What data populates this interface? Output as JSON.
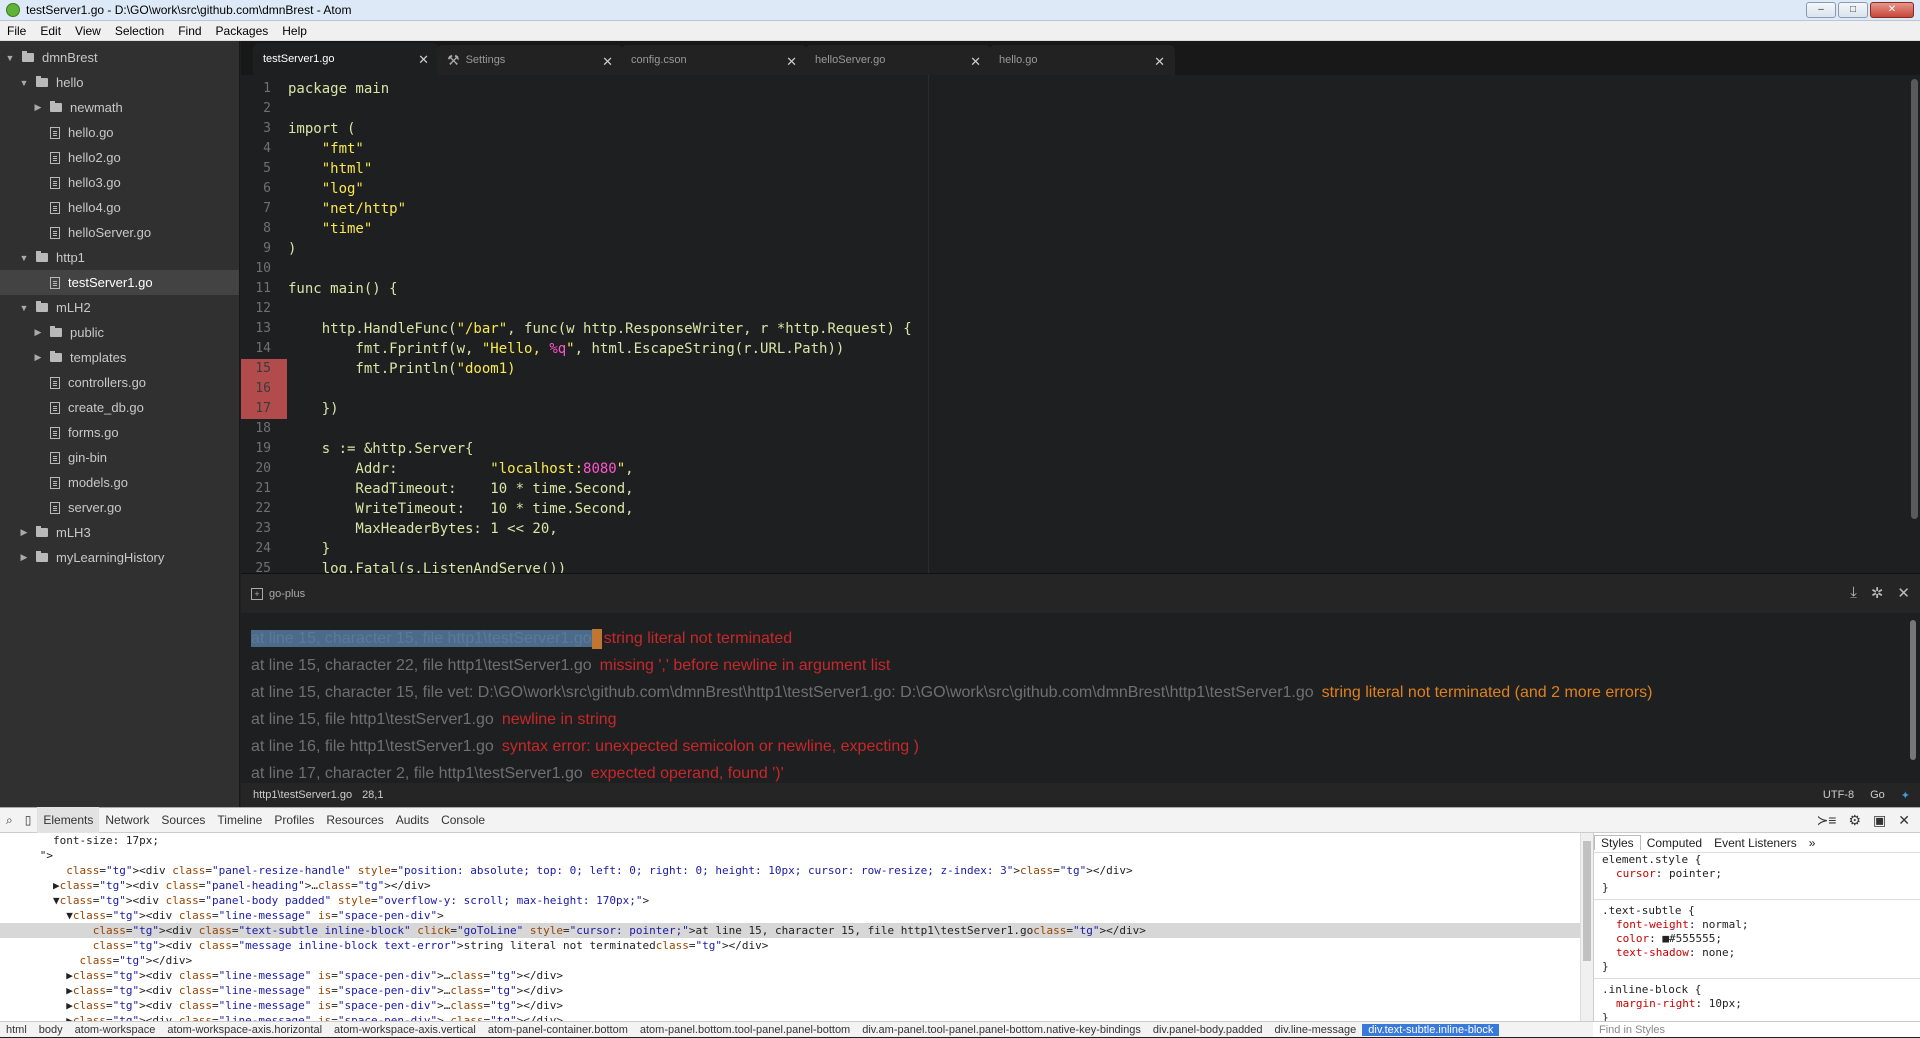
{
  "window": {
    "title": "testServer1.go - D:\\GO\\work\\src\\github.com\\dmnBrest - Atom",
    "min": "–",
    "max": "□",
    "close": "✕"
  },
  "menu": [
    "File",
    "Edit",
    "View",
    "Selection",
    "Find",
    "Packages",
    "Help"
  ],
  "tree": [
    {
      "label": "dmnBrest",
      "type": "folder",
      "depth": 0,
      "open": true
    },
    {
      "label": "hello",
      "type": "folder",
      "depth": 1,
      "open": true
    },
    {
      "label": "newmath",
      "type": "folder",
      "depth": 2,
      "open": false
    },
    {
      "label": "hello.go",
      "type": "file",
      "depth": 2
    },
    {
      "label": "hello2.go",
      "type": "file",
      "depth": 2
    },
    {
      "label": "hello3.go",
      "type": "file",
      "depth": 2
    },
    {
      "label": "hello4.go",
      "type": "file",
      "depth": 2
    },
    {
      "label": "helloServer.go",
      "type": "file",
      "depth": 2
    },
    {
      "label": "http1",
      "type": "folder",
      "depth": 1,
      "open": true
    },
    {
      "label": "testServer1.go",
      "type": "file",
      "depth": 2,
      "selected": true
    },
    {
      "label": "mLH2",
      "type": "folder",
      "depth": 1,
      "open": true
    },
    {
      "label": "public",
      "type": "folder",
      "depth": 2,
      "open": false
    },
    {
      "label": "templates",
      "type": "folder",
      "depth": 2,
      "open": false
    },
    {
      "label": "controllers.go",
      "type": "file",
      "depth": 2
    },
    {
      "label": "create_db.go",
      "type": "file",
      "depth": 2
    },
    {
      "label": "forms.go",
      "type": "file",
      "depth": 2
    },
    {
      "label": "gin-bin",
      "type": "file",
      "depth": 2
    },
    {
      "label": "models.go",
      "type": "file",
      "depth": 2
    },
    {
      "label": "server.go",
      "type": "file",
      "depth": 2
    },
    {
      "label": "mLH3",
      "type": "folder",
      "depth": 1,
      "open": false
    },
    {
      "label": "myLearningHistory",
      "type": "folder",
      "depth": 1,
      "open": false
    }
  ],
  "tabs": [
    {
      "label": "testServer1.go",
      "active": true
    },
    {
      "label": "Settings",
      "icon": "settings"
    },
    {
      "label": "config.cson"
    },
    {
      "label": "helloServer.go"
    },
    {
      "label": "hello.go"
    }
  ],
  "code": [
    {
      "n": "1",
      "t": "package main"
    },
    {
      "n": "2",
      "t": ""
    },
    {
      "n": "3",
      "t": "import ("
    },
    {
      "n": "4",
      "t": "    \"fmt\""
    },
    {
      "n": "5",
      "t": "    \"html\""
    },
    {
      "n": "6",
      "t": "    \"log\""
    },
    {
      "n": "7",
      "t": "    \"net/http\""
    },
    {
      "n": "8",
      "t": "    \"time\""
    },
    {
      "n": "9",
      "t": ")"
    },
    {
      "n": "10",
      "t": ""
    },
    {
      "n": "11",
      "t": "func main() {"
    },
    {
      "n": "12",
      "t": ""
    },
    {
      "n": "13",
      "t": "    http.HandleFunc(\"/bar\", func(w http.ResponseWriter, r *http.Request) {"
    },
    {
      "n": "14",
      "t": "        fmt.Fprintf(w, \"Hello, %q\", html.EscapeString(r.URL.Path))"
    },
    {
      "n": "15",
      "t": "        fmt.Println(\"doom1)",
      "err": true
    },
    {
      "n": "16",
      "t": "",
      "err": true
    },
    {
      "n": "17",
      "t": "    })",
      "err": true
    },
    {
      "n": "18",
      "t": ""
    },
    {
      "n": "19",
      "t": "    s := &http.Server{"
    },
    {
      "n": "20",
      "t": "        Addr:           \"localhost:8080\","
    },
    {
      "n": "21",
      "t": "        ReadTimeout:    10 * time.Second,"
    },
    {
      "n": "22",
      "t": "        WriteTimeout:   10 * time.Second,"
    },
    {
      "n": "23",
      "t": "        MaxHeaderBytes: 1 << 20,"
    },
    {
      "n": "24",
      "t": "    }"
    },
    {
      "n": "25",
      "t": "    log.Fatal(s.ListenAndServe())"
    }
  ],
  "panel": {
    "title": "go-plus",
    "messages": [
      {
        "loc": "at line 15, character 15, file http1\\testServer1.go",
        "msg": "string literal not terminated",
        "kind": "error",
        "highlight": true
      },
      {
        "loc": "at line 15, character 22, file http1\\testServer1.go",
        "msg": "missing ',' before newline in argument list",
        "kind": "error"
      },
      {
        "loc": "at line 15, character 15, file vet: D:\\GO\\work\\src\\github.com\\dmnBrest\\http1\\testServer1.go: D:\\GO\\work\\src\\github.com\\dmnBrest\\http1\\testServer1.go",
        "msg": "string literal not terminated (and 2 more errors)",
        "kind": "warning"
      },
      {
        "loc": "at line 15, file http1\\testServer1.go",
        "msg": "newline in string",
        "kind": "error"
      },
      {
        "loc": "at line 16, file http1\\testServer1.go",
        "msg": "syntax error: unexpected semicolon or newline, expecting )",
        "kind": "error"
      },
      {
        "loc": "at line 17, character 2, file http1\\testServer1.go",
        "msg": "expected operand, found ')'",
        "kind": "error"
      }
    ]
  },
  "status": {
    "path": "http1\\testServer1.go",
    "cursor": "28,1",
    "encoding": "UTF-8",
    "grammar": "Go"
  },
  "devtools": {
    "tabs": [
      "Elements",
      "Network",
      "Sources",
      "Timeline",
      "Profiles",
      "Resources",
      "Audits",
      "Console"
    ],
    "dom": [
      "        font-size: 17px;",
      "      \">",
      "          <div class=\"panel-resize-handle\" style=\"position: absolute; top: 0; left: 0; right: 0; height: 10px; cursor: row-resize; z-index: 3\"></div>",
      "        ▶<div class=\"panel-heading\">…</div>",
      "        ▼<div class=\"panel-body padded\" style=\"overflow-y: scroll; max-height: 170px;\">",
      "          ▼<div class=\"line-message\" is=\"space-pen-div\">",
      "              <div class=\"text-subtle inline-block\" click=\"goToLine\" style=\"cursor: pointer;\">at line 15, character 15, file http1\\testServer1.go</div>",
      "              <div class=\"message inline-block text-error\">string literal not terminated</div>",
      "            </div>",
      "          ▶<div class=\"line-message\" is=\"space-pen-div\">…</div>",
      "          ▶<div class=\"line-message\" is=\"space-pen-div\">…</div>",
      "          ▶<div class=\"line-message\" is=\"space-pen-div\">…</div>",
      "          ▶<div class=\"line-message\" is=\"space-pen-div\">…</div>"
    ],
    "dom_selected_index": 6,
    "style_tabs": [
      "Styles",
      "Computed",
      "Event Listeners",
      "»"
    ],
    "styles": [
      {
        "sel": "element.style {",
        "props": [
          [
            "cursor",
            "pointer;"
          ]
        ]
      },
      {
        "sel": ".text-subtle {",
        "props": [
          [
            "font-weight",
            "normal;"
          ],
          [
            "color",
            "■#555555;"
          ],
          [
            "text-shadow",
            "none;"
          ]
        ]
      },
      {
        "sel": ".inline-block {",
        "props": [
          [
            "margin-right",
            "10px;"
          ]
        ]
      }
    ],
    "find_placeholder": "Find in Styles",
    "breadcrumb": [
      "html",
      "body",
      "atom-workspace",
      "atom-workspace-axis.horizontal",
      "atom-workspace-axis.vertical",
      "atom-panel-container.bottom",
      "atom-panel.bottom.tool-panel.panel-bottom",
      "div.am-panel.tool-panel.panel-bottom.native-key-bindings",
      "div.panel-body.padded",
      "div.line-message",
      "div.text-subtle.inline-block"
    ]
  }
}
